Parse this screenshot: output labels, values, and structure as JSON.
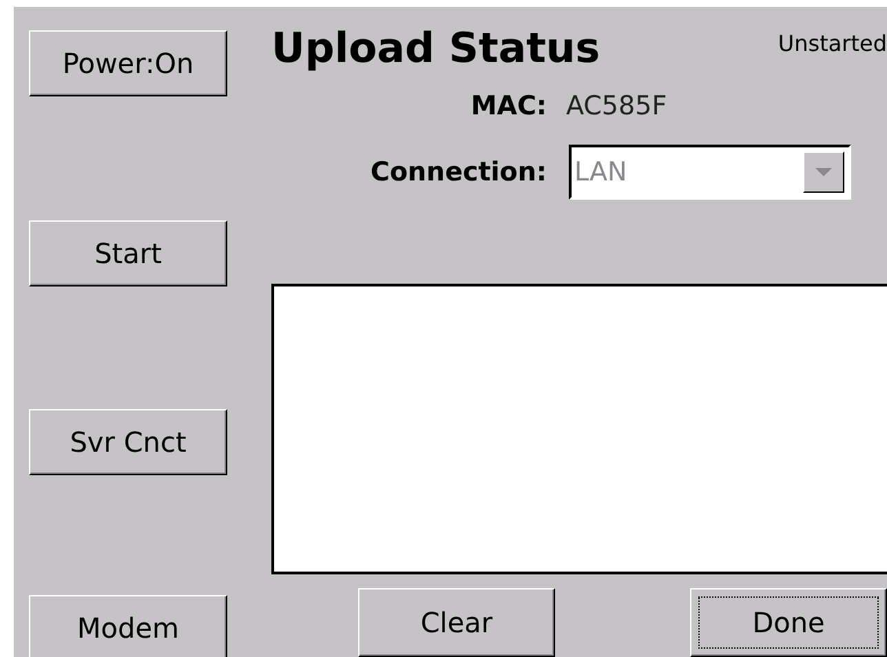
{
  "title": "Upload Status",
  "status": "Unstarted",
  "side_buttons": [
    {
      "label": "Power:On",
      "focused": false
    },
    {
      "label": "Start",
      "focused": false
    },
    {
      "label": "Svr Cnct",
      "focused": false
    },
    {
      "label": "Modem",
      "focused": false
    }
  ],
  "mac": {
    "label": "MAC:",
    "value": "AC585F"
  },
  "connection": {
    "label": "Connection:",
    "value": "LAN",
    "disabled": true
  },
  "bottom_buttons": [
    {
      "label": "Clear",
      "focused": false
    },
    {
      "label": "Done",
      "focused": true
    }
  ]
}
